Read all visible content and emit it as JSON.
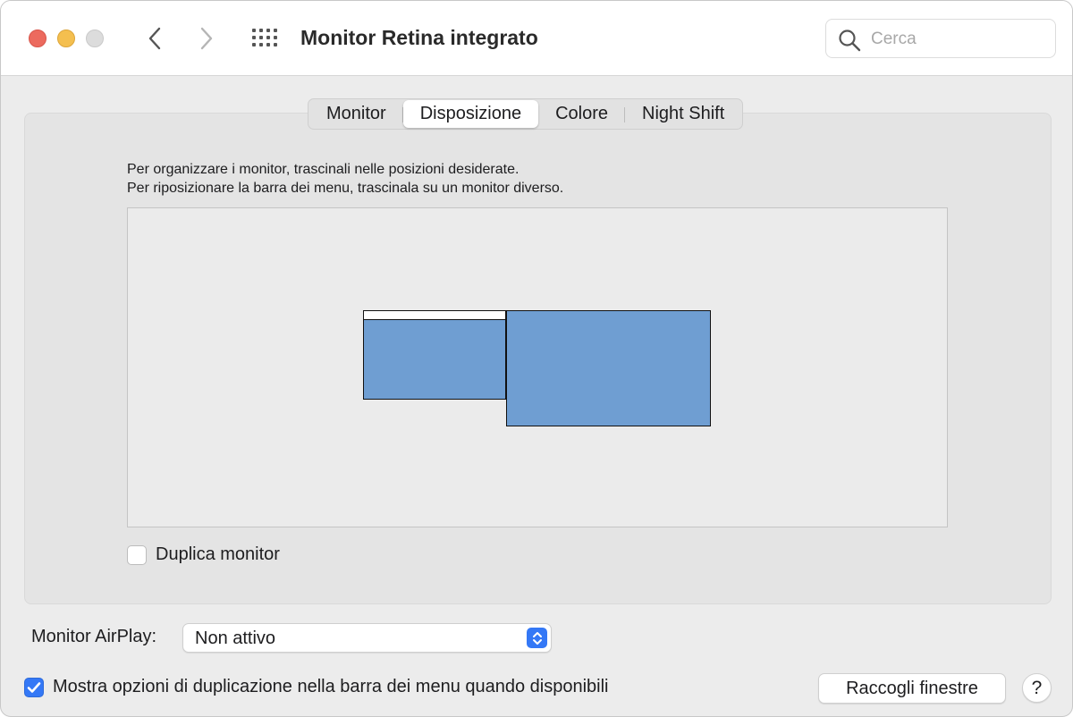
{
  "window": {
    "title": "Monitor Retina integrato"
  },
  "toolbar": {
    "back_icon": "chevron-left-icon",
    "forward_icon": "chevron-right-icon",
    "grid_icon": "grid-icon"
  },
  "search": {
    "placeholder": "Cerca",
    "icon": "search-icon"
  },
  "tabs": [
    {
      "label": "Monitor",
      "active": false
    },
    {
      "label": "Disposizione",
      "active": true
    },
    {
      "label": "Colore",
      "active": false
    },
    {
      "label": "Night Shift",
      "active": false
    }
  ],
  "arrangement": {
    "instruction_line1": "Per organizzare i monitor, trascinali nelle posizioni desiderate.",
    "instruction_line2": "Per riposizionare la barra dei menu, trascinala su un monitor diverso."
  },
  "mirror": {
    "label": "Duplica monitor",
    "checked": false
  },
  "airplay": {
    "label": "Monitor AirPlay:",
    "selected": "Non attivo"
  },
  "show_options": {
    "label": "Mostra opzioni di duplicazione nella barra dei menu quando disponibili",
    "checked": true
  },
  "buttons": {
    "gather": "Raccogli finestre",
    "help": "?"
  },
  "colors": {
    "accent": "#3478f6",
    "display_fill": "#6f9ed2",
    "close": "#ec6a5e",
    "minimize": "#f4bf4f",
    "maximize_disabled": "#dcdcdc"
  }
}
